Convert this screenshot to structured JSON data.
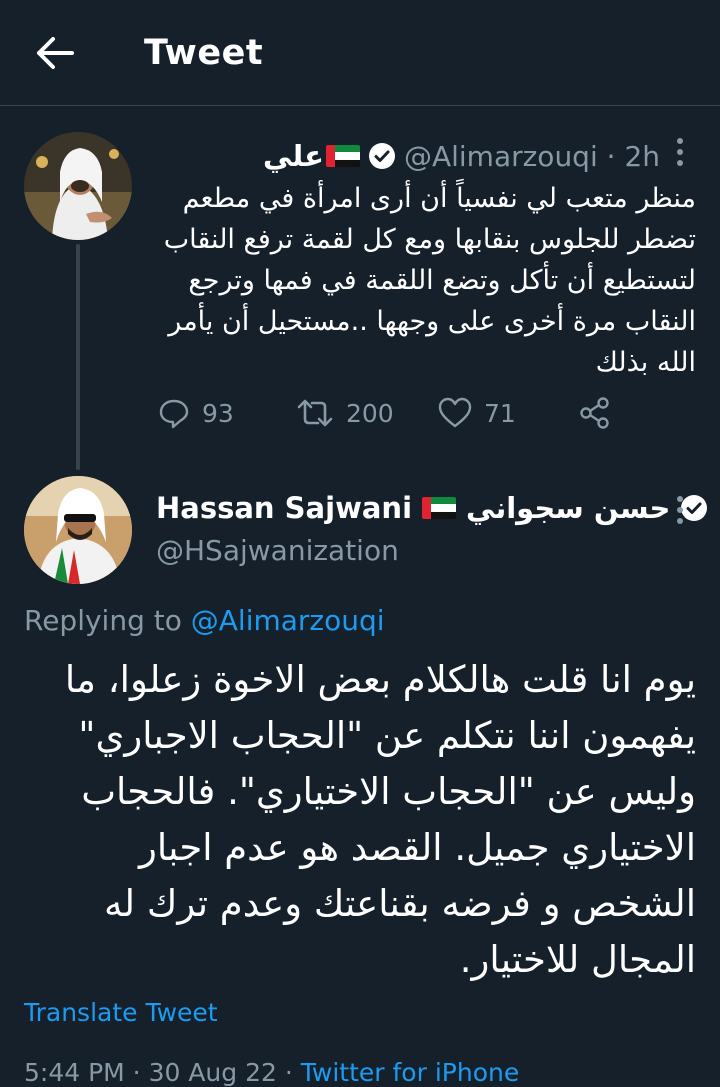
{
  "header": {
    "title": "Tweet"
  },
  "parent_tweet": {
    "display_name": "علي",
    "handle_time": "@Alimarzouqi · 2h",
    "text": "منظر متعب لي نفسياً أن أرى امرأة في مطعم تضطر للجلوس بنقابها ومع كل لقمة ترفع النقاب لتستطيع أن تأكل وتضع اللقمة في فمها وترجع النقاب مرة أخرى على وجهها ..مستحيل أن يأمر الله بذلك",
    "replies": "93",
    "retweets": "200",
    "likes": "71"
  },
  "main_tweet": {
    "name_en": "Hassan Sajwani",
    "name_ar": "حسن سجواني",
    "handle": "@HSajwanization",
    "replying_label": "Replying to",
    "replying_handle": "@Alimarzouqi",
    "text": "يوم انا قلت هالكلام بعض الاخوة زعلوا، ما يفهمون اننا نتكلم عن \"الحجاب الاجباري\" وليس عن \"الحجاب الاختياري\". فالحجاب الاختياري جميل. القصد هو عدم اجبار الشخص و فرضه بقناعتك وعدم ترك له المجال للاختيار.",
    "translate_label": "Translate Tweet",
    "timestamp": "5:44 PM · 30 Aug 22 ·",
    "source": "Twitter for iPhone"
  },
  "colors": {
    "background": "#15202b",
    "muted": "#8899a6",
    "accent": "#1d9bf0",
    "divider": "#38444d"
  }
}
